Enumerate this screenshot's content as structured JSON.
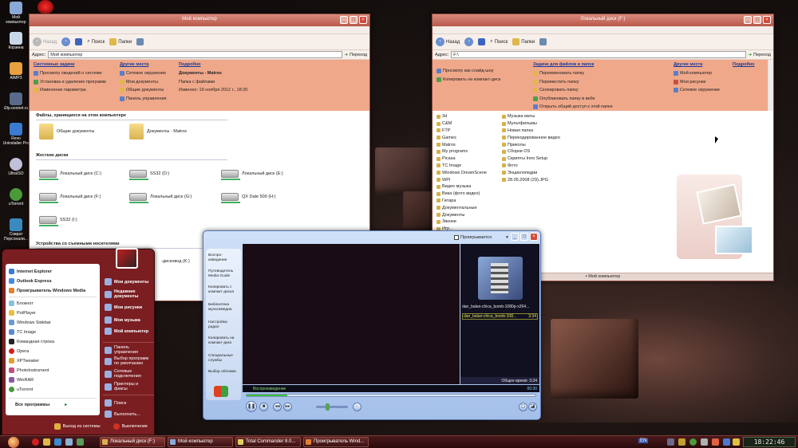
{
  "desktop_icons": [
    {
      "label": "Мой компьютер",
      "icon": "computer-icon"
    },
    {
      "label": "Корзина",
      "icon": "recycle-bin-icon"
    },
    {
      "label": "AIMP3",
      "icon": "aimp-icon"
    },
    {
      "label": "i2tp.ooonet.ru",
      "icon": "network-icon"
    },
    {
      "label": "Revo Uninstaller Pro",
      "icon": "revo-icon"
    },
    {
      "label": "UltraISO",
      "icon": "disc-icon"
    },
    {
      "label": "uTorrent",
      "icon": "utorrent-icon"
    },
    {
      "label": "Соврат Персонали...",
      "icon": "app-icon"
    }
  ],
  "left_window": {
    "title": "Мой компьютер",
    "toolbar": {
      "back": "Назад",
      "search": "Поиск",
      "folders": "Папки"
    },
    "address_label": "Адрес:",
    "address_value": "Мой компьютер",
    "go_label": "Переход",
    "tasks": {
      "system_head": "Системные задачи",
      "system_items": [
        "Просмотр сведений о системе",
        "Установка и удаление программ",
        "Изменение параметра"
      ],
      "other_head": "Другие места",
      "other_items": [
        "Сетевое окружение",
        "Мои документы",
        "Общие документы",
        "Панель управления"
      ],
      "details_head": "Подробно",
      "details_items": [
        "Документы - Matros",
        "Папка с файлами",
        "Изменен: 19 ноября 2012 г., 18:20"
      ]
    },
    "sections": {
      "files": "Файлы, хранящиеся на этом компьютере",
      "drives": "Жесткие диски",
      "removable": "Устройства со съемными носителями"
    },
    "folders": [
      "Общие документы",
      "Документы - Matros"
    ],
    "drives": [
      "Локальный диск (C:)",
      "SS32 (D:)",
      "Локальный диск (E:)",
      "Локальный диск (F:)",
      "Локальный диск (G:)",
      "QX Date 500 (H:)",
      "SS32 (I:)"
    ],
    "removable_partial": "-дисковод (K:)"
  },
  "right_window": {
    "title": "Локальный диск (F:)",
    "toolbar": {
      "back": "Назад",
      "search": "Поиск",
      "folders": "Папки"
    },
    "address_label": "Адрес:",
    "address_value": "F:\\",
    "go_label": "Переход",
    "tasks": {
      "pics_items": [
        "Просмотр как слайд-шоу",
        "Копировать на компакт-диск"
      ],
      "file_head": "Задачи для файлов и папок",
      "file_items": [
        "Переименовать папку",
        "Переместить папку",
        "Скопировать папку",
        "Опубликовать папку в вебе",
        "Открыть общий доступ к этой папке"
      ],
      "other_head": "Другие места",
      "other_items": [
        "Мой компьютер",
        "Мои рисунки",
        "Сетевое окружение"
      ],
      "details_head": "Подробно"
    },
    "files_col1": [
      "3d",
      "C&M",
      "FTP",
      "Games",
      "Matros",
      "My programs",
      "Picasa",
      "TC Image",
      "Windows DreamScene",
      "WPI",
      "Видео музыка",
      "Вика (фото видео)",
      "Гитара",
      "Документальные",
      "Документы",
      "Звонки",
      "Игр..."
    ],
    "files_col2": [
      "Музыка маты",
      "Мультфильмы",
      "Новая папка",
      "Перекодированное видео",
      "Приколы",
      "Сборки OS",
      "Скрипты Inno Setup",
      "Фото",
      "Энциклопедии",
      "28.05.2008 (29).JPG"
    ],
    "status": "Мой компьютер"
  },
  "media_player": {
    "now_playing_label": "Проигрывается",
    "nav": [
      "Воспро-изведение",
      "Путеводитель Media Guide",
      "Копировать с компакт-диска",
      "Библиотека мультимедиа",
      "Настройка радио",
      "Копировать на компакт-диск",
      "Специальные службы",
      "Выбор обложки"
    ],
    "thumb_caption": "dan_balan-chica_bomb-1080p-x264...",
    "playlist": [
      {
        "title": "dan_balan-chica_bomb-108...",
        "time": "3:34"
      }
    ],
    "total_time_label": "Общее время: 3:34",
    "status": "Воспроизведение",
    "elapsed": "00:30",
    "progress": 0.14
  },
  "start_menu": {
    "pinned": [
      "Internet Explorer",
      "Outlook Express",
      "Проигрыватель Windows Media"
    ],
    "recent": [
      "Блокнот",
      "PotPlayer",
      "Windows Sidebar",
      "TC Image",
      "Командная строка",
      "Opera",
      "XPTweaker",
      "PhotoInstrument",
      "WinRAR",
      "uTorrent"
    ],
    "all_programs": "Все программы",
    "right": [
      "Мои документы",
      "Недавние документы",
      "Мои рисунки",
      "Моя музыка",
      "Мой компьютер",
      "Панель управления",
      "Выбор программ по умолчанию",
      "Сетевые подключения",
      "Принтеры и факсы",
      "Поиск",
      "Выполнить..."
    ],
    "logoff": "Выход из системы",
    "shutdown": "Выключение"
  },
  "taskbar": {
    "tasks": [
      "Локальный диск (F:)",
      "Мой компьютер",
      "Total Commander 8.0...",
      "Проигрыватель Wind..."
    ],
    "lang": "EN",
    "clock": "18:22:46"
  }
}
